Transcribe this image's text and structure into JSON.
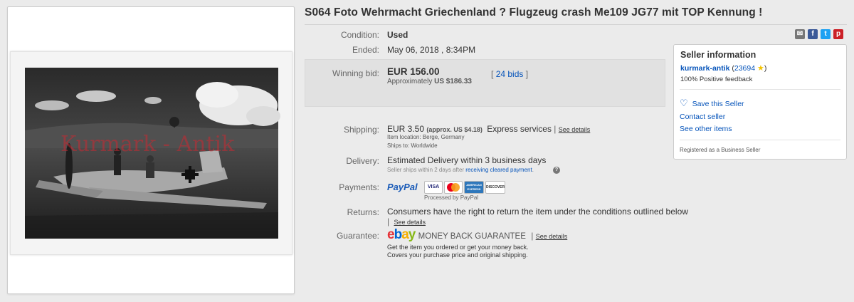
{
  "title": "S064 Foto Wehrmacht Griechenland ? Flugzeug crash Me109 JG77 mit TOP Kennung !",
  "photo": {
    "watermark": "Kurmark - Antik"
  },
  "details": {
    "condition_label": "Condition:",
    "condition_value": "Used",
    "ended_label": "Ended:",
    "ended_value": "May 06, 2018 , 8:34PM"
  },
  "bid": {
    "label": "Winning bid:",
    "amount": "EUR 156.00",
    "approx_prefix": "Approximately",
    "approx_value": "US $186.33",
    "bids_open": "[",
    "bids_link": "24 bids",
    "bids_close": "]"
  },
  "shipping": {
    "label": "Shipping:",
    "amount": "EUR 3.50",
    "approx": "(approx. US $4.18)",
    "service": "Express services",
    "separator": "|",
    "see_details": "See details",
    "location_label": "Item location:",
    "location_value": "Berge, Germany",
    "ships_to_label": "Ships to:",
    "ships_to_value": "Worldwide"
  },
  "delivery": {
    "label": "Delivery:",
    "value": "Estimated Delivery within 3 business days",
    "note_prefix": "Seller ships within 2 days after",
    "note_link": "receiving cleared payment",
    "note_suffix": "."
  },
  "payments": {
    "label": "Payments:",
    "paypal": "PayPal",
    "visa": "VISA",
    "amex": "AMERICAN EXPRESS",
    "discover": "DISCOVER",
    "processed": "Processed by PayPal"
  },
  "returns": {
    "label": "Returns:",
    "value": "Consumers have the right to return the item under the conditions outlined below",
    "separator": "|",
    "see_details": "See details"
  },
  "guarantee": {
    "label": "Guarantee:",
    "ebay": "ebay",
    "money_back": "MONEY BACK GUARANTEE",
    "separator": "|",
    "see_details": "See details",
    "line1": "Get the item you ordered or get your money back.",
    "line2": "Covers your purchase price and original shipping."
  },
  "seller": {
    "heading": "Seller information",
    "name": "kurmark-antik",
    "feedback_open": "(",
    "feedback_score": "23694",
    "feedback_close": ")",
    "positive": "100% Positive feedback",
    "save": "Save this Seller",
    "contact": "Contact seller",
    "see_other": "See other items",
    "registered": "Registered as a Business Seller"
  },
  "share_icons": [
    "email-icon",
    "facebook-icon",
    "twitter-icon",
    "pinterest-icon"
  ],
  "colors": {
    "link": "#0654ba",
    "ebay_red": "#e53238",
    "ebay_blue": "#0064d2",
    "ebay_yellow": "#f5af02",
    "ebay_green": "#86b817",
    "facebook": "#3b5998",
    "twitter": "#1da1f2",
    "pinterest": "#cb2027"
  }
}
